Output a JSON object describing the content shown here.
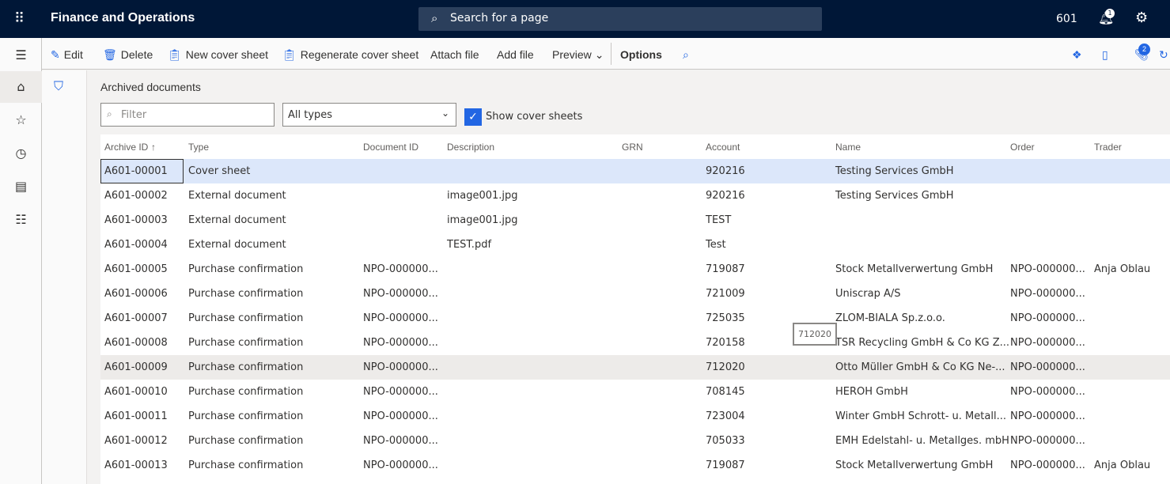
{
  "header": {
    "title": "Finance and Operations",
    "search_placeholder": "Search for a page",
    "company": "601",
    "notifications": "1"
  },
  "toolbar": {
    "edit": "Edit",
    "delete": "Delete",
    "new_cover": "New cover sheet",
    "regen_cover": "Regenerate cover sheet",
    "attach": "Attach file",
    "add": "Add file",
    "preview": "Preview",
    "options": "Options",
    "attachments_count": "2"
  },
  "page": {
    "caption": "Archived documents",
    "filter_placeholder": "Filter",
    "type_select": "All types",
    "show_cover": "Show cover sheets",
    "show_cover_checked": true
  },
  "columns": [
    "Archive ID",
    "Type",
    "Document ID",
    "Description",
    "GRN",
    "Account",
    "Name",
    "Order",
    "Trader"
  ],
  "rows": [
    [
      "A601-00001",
      "Cover sheet",
      "",
      "",
      "",
      "920216",
      "Testing Services GmbH",
      "",
      ""
    ],
    [
      "A601-00002",
      "External document",
      "",
      "image001.jpg",
      "",
      "920216",
      "Testing Services GmbH",
      "",
      ""
    ],
    [
      "A601-00003",
      "External document",
      "",
      "image001.jpg",
      "",
      "TEST",
      "",
      "",
      ""
    ],
    [
      "A601-00004",
      "External document",
      "",
      "TEST.pdf",
      "",
      "Test",
      "",
      "",
      ""
    ],
    [
      "A601-00005",
      "Purchase confirmation",
      "NPO-000000...",
      "",
      "",
      "719087",
      "Stock Metallverwertung GmbH",
      "NPO-000000...",
      "Anja Oblau"
    ],
    [
      "A601-00006",
      "Purchase confirmation",
      "NPO-000000...",
      "",
      "",
      "721009",
      "Uniscrap A/S",
      "NPO-000000...",
      ""
    ],
    [
      "A601-00007",
      "Purchase confirmation",
      "NPO-000000...",
      "",
      "",
      "725035",
      "ZLOM-BIALA Sp.z.o.o.",
      "NPO-000000...",
      ""
    ],
    [
      "A601-00008",
      "Purchase confirmation",
      "NPO-000000...",
      "",
      "",
      "720158",
      "TSR Recycling GmbH & Co KG Z...",
      "NPO-000000...",
      ""
    ],
    [
      "A601-00009",
      "Purchase confirmation",
      "NPO-000000...",
      "",
      "",
      "712020",
      "Otto Müller GmbH & Co KG Ne-...",
      "NPO-000000...",
      ""
    ],
    [
      "A601-00010",
      "Purchase confirmation",
      "NPO-000000...",
      "",
      "",
      "708145",
      "HEROH GmbH",
      "NPO-000000...",
      ""
    ],
    [
      "A601-00011",
      "Purchase confirmation",
      "NPO-000000...",
      "",
      "",
      "723004",
      "Winter GmbH Schrott- u. Metall...",
      "NPO-000000...",
      ""
    ],
    [
      "A601-00012",
      "Purchase confirmation",
      "NPO-000000...",
      "",
      "",
      "705033",
      "EMH Edelstahl- u. Metallges. mbH",
      "NPO-000000...",
      ""
    ],
    [
      "A601-00013",
      "Purchase confirmation",
      "NPO-000000...",
      "",
      "",
      "719087",
      "Stock Metallverwertung GmbH",
      "NPO-000000...",
      "Anja Oblau"
    ]
  ],
  "tooltip": "712020",
  "colors": {
    "accent": "#2266e3",
    "topbar": "#001737"
  }
}
